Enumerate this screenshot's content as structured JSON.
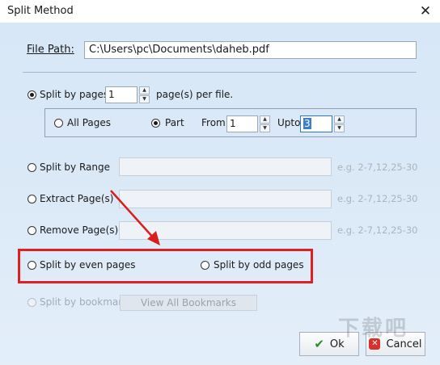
{
  "window": {
    "title": "Split Method"
  },
  "file_path": {
    "label": "File Path:",
    "value": "C:\\Users\\pc\\Documents\\daheb.pdf"
  },
  "split_by_pages": {
    "label": "Split by pages",
    "value": "1",
    "suffix": "page(s) per file.",
    "all_pages_label": "All Pages",
    "part_label": "Part",
    "from_label": "From",
    "from_value": "1",
    "upto_label": "Upto",
    "upto_value": "3"
  },
  "split_by_range": {
    "label": "Split by Range",
    "hint": "e.g. 2-7,12,25-30"
  },
  "extract_pages": {
    "label": "Extract Page(s)",
    "hint": "e.g. 2-7,12,25-30"
  },
  "remove_pages": {
    "label": "Remove Page(s)",
    "hint": "e.g. 2-7,12,25-30"
  },
  "split_even": {
    "label": "Split by even pages"
  },
  "split_odd": {
    "label": "Split by odd pages"
  },
  "split_bookmark": {
    "label": "Split by bookmark",
    "button": "View All Bookmarks"
  },
  "buttons": {
    "ok": "Ok",
    "cancel": "Cancel"
  },
  "watermark": {
    "text": "下载吧"
  },
  "colors": {
    "highlight_box": "#e02020",
    "arrow": "#d91e1e",
    "link_blue": "#0a5fc4",
    "background": "#dbe9f7"
  }
}
